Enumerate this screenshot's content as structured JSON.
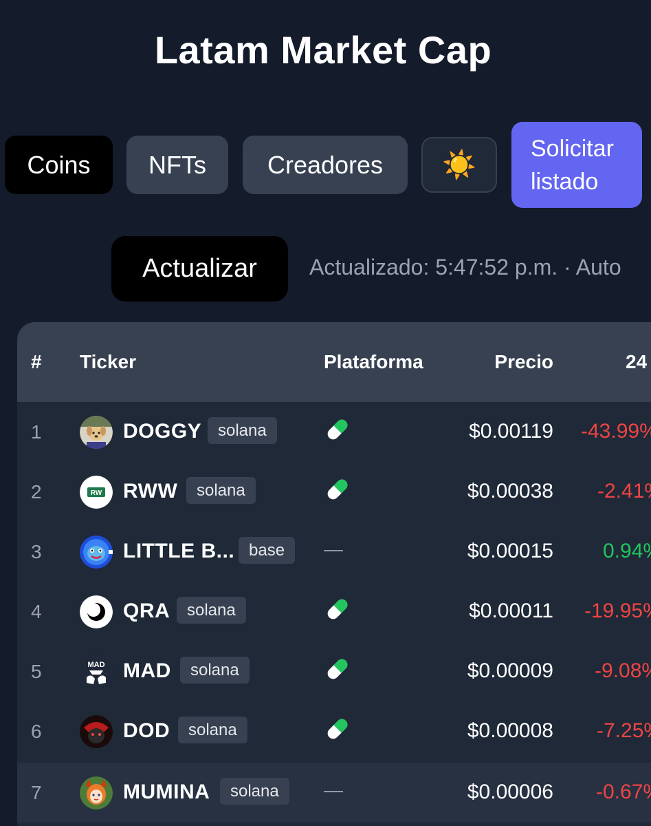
{
  "header": {
    "title": "Latam Market Cap"
  },
  "nav": {
    "coins_label": "Coins",
    "nfts_label": "NFTs",
    "creadores_label": "Creadores",
    "theme_icon": "☀️",
    "solicitar_label": "Solicitar listado"
  },
  "toolbar": {
    "refresh_label": "Actualizar",
    "updated_text": "Actualizado: 5:47:52 p.m. · Auto"
  },
  "table": {
    "columns": {
      "rank": "#",
      "ticker": "Ticker",
      "platform": "Plataforma",
      "price": "Precio",
      "change": "24"
    },
    "rows": [
      {
        "rank": "1",
        "ticker": "DOGGY",
        "chain": "solana",
        "platform": "pill-icon",
        "price": "$0.00119",
        "change": "-43.99%",
        "change_dir": "negative",
        "avatar": "doggy-avatar-icon"
      },
      {
        "rank": "2",
        "ticker": "RWW",
        "chain": "solana",
        "platform": "pill-icon",
        "price": "$0.00038",
        "change": "-2.41%",
        "change_dir": "negative",
        "avatar": "rww-logo-icon",
        "avatar_text": "RW"
      },
      {
        "rank": "3",
        "ticker": "LITTLE B...",
        "chain": "base",
        "platform": "—",
        "price": "$0.00015",
        "change": "0.94%",
        "change_dir": "positive",
        "avatar": "little-b-avatar-icon"
      },
      {
        "rank": "4",
        "ticker": "QRA",
        "chain": "solana",
        "platform": "pill-icon",
        "price": "$0.00011",
        "change": "-19.95%",
        "change_dir": "negative",
        "avatar": "qra-moon-icon"
      },
      {
        "rank": "5",
        "ticker": "MAD",
        "chain": "solana",
        "platform": "pill-icon",
        "price": "$0.00009",
        "change": "-9.08%",
        "change_dir": "negative",
        "avatar": "mad-logo-icon",
        "avatar_text": "MAD"
      },
      {
        "rank": "6",
        "ticker": "DOD",
        "chain": "solana",
        "platform": "pill-icon",
        "price": "$0.00008",
        "change": "-7.25%",
        "change_dir": "negative",
        "avatar": "dod-avatar-icon"
      },
      {
        "rank": "7",
        "ticker": "MUMINA",
        "chain": "solana",
        "platform": "—",
        "price": "$0.00006",
        "change": "-0.67%",
        "change_dir": "negative",
        "avatar": "mumina-avatar-icon"
      }
    ]
  },
  "colors": {
    "background": "#141b2b",
    "accent": "#6366f1",
    "negative": "#ef4444",
    "positive": "#22c55e"
  }
}
